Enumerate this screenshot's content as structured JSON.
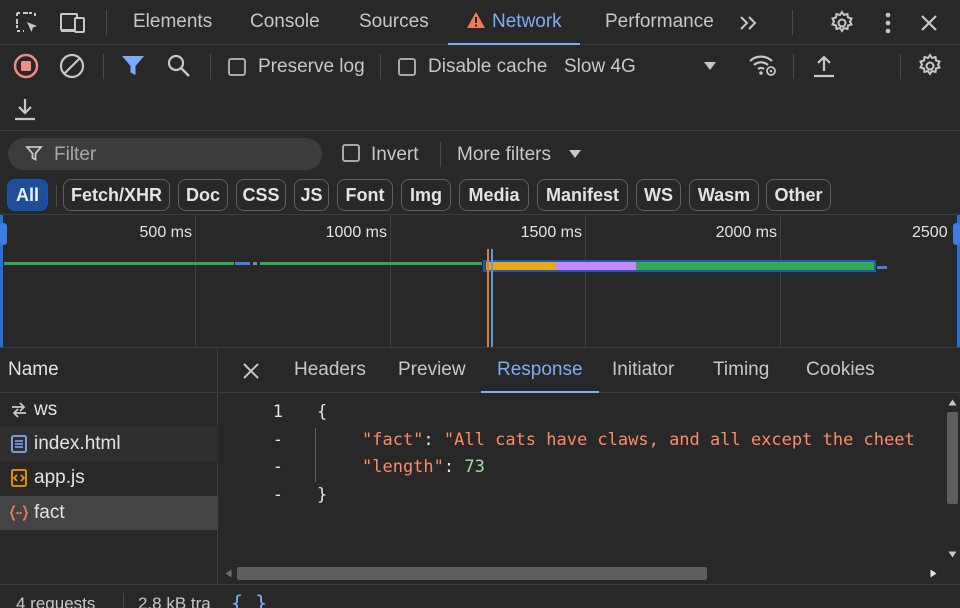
{
  "topbar": {
    "tabs": [
      "Elements",
      "Console",
      "Sources",
      "Network",
      "Performance"
    ],
    "active_tab": "Network",
    "icons": [
      "inspect-element-icon",
      "device-toolbar-icon",
      "more-tabs-icon",
      "settings-gear-icon",
      "kebab-menu-icon",
      "close-icon"
    ]
  },
  "toolbar": {
    "preserve_log": "Preserve log",
    "disable_cache": "Disable cache",
    "throttling": "Slow 4G",
    "icons": [
      "record-stop-icon",
      "clear-icon",
      "filter-funnel-icon",
      "search-icon",
      "network-conditions-icon",
      "import-har-icon",
      "network-settings-gear-icon",
      "export-har-icon"
    ]
  },
  "filterbar": {
    "filter_placeholder": "Filter",
    "invert": "Invert",
    "more_filters": "More filters",
    "chips": [
      "All",
      "Fetch/XHR",
      "Doc",
      "CSS",
      "JS",
      "Font",
      "Img",
      "Media",
      "Manifest",
      "WS",
      "Wasm",
      "Other"
    ],
    "active_chip": "All"
  },
  "overview": {
    "ticks": [
      "500 ms",
      "1000 ms",
      "1500 ms",
      "2000 ms",
      "2500 ms"
    ]
  },
  "requests": {
    "header": "Name",
    "rows": [
      {
        "name": "ws",
        "icon": "websocket-icon"
      },
      {
        "name": "index.html",
        "icon": "document-icon"
      },
      {
        "name": "app.js",
        "icon": "script-icon"
      },
      {
        "name": "fact",
        "icon": "json-fetch-icon"
      }
    ],
    "selected": "fact"
  },
  "detail": {
    "tabs": [
      "Headers",
      "Preview",
      "Response",
      "Initiator",
      "Timing",
      "Cookies"
    ],
    "active_tab": "Response",
    "line_numbers": [
      "1",
      "-",
      "-",
      "-"
    ],
    "code": {
      "open": "{",
      "fact_key": "\"fact\"",
      "fact_value": "\"All cats have claws, and all except the cheet",
      "length_key": "\"length\"",
      "length_value": "73",
      "close": "}"
    }
  },
  "status": {
    "requests": "4 requests",
    "transferred": "2.8 kB tra",
    "format_button": "{ }"
  },
  "colors": {
    "accent": "#7cacf8",
    "background": "#282828",
    "json_key": "#ff8a65",
    "json_number": "#a8dba8",
    "record_red": "#f28b82"
  }
}
